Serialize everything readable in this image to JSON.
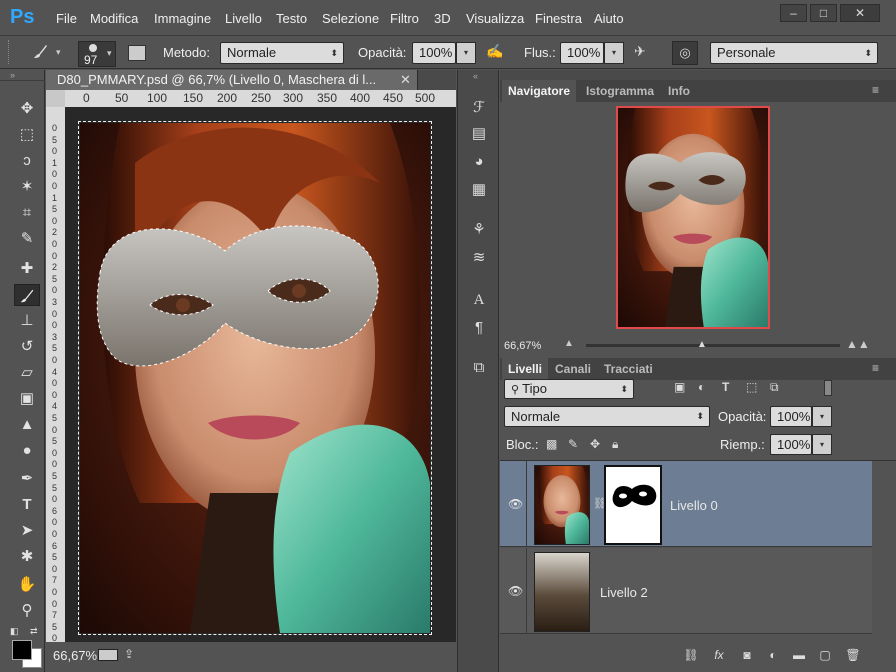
{
  "app": {
    "logo": "Ps",
    "menu": [
      "File",
      "Modifica",
      "Immagine",
      "Livello",
      "Testo",
      "Selezione",
      "Filtro",
      "3D",
      "Visualizza",
      "Finestra",
      "Aiuto"
    ],
    "window_controls": [
      "–",
      "□",
      "✕"
    ]
  },
  "options": {
    "brush_size": "97",
    "metodo_label": "Metodo:",
    "metodo_value": "Normale",
    "opacita_label": "Opacità:",
    "opacita_value": "100%",
    "flusso_label": "Flus.:",
    "flusso_value": "100%",
    "preset_value": "Personale"
  },
  "document": {
    "tab_title": "D80_PMMARY.psd @ 66,7% (Livello 0, Maschera di l...",
    "ruler_top": [
      "0",
      "50",
      "100",
      "150",
      "200",
      "250",
      "300",
      "350",
      "400",
      "450",
      "500"
    ],
    "ruler_left": [
      "0",
      "5",
      "0",
      "1",
      "0",
      "0",
      "1",
      "5",
      "0",
      "2",
      "0",
      "0",
      "2",
      "5",
      "0",
      "3",
      "0",
      "0",
      "3",
      "5",
      "0",
      "4",
      "0",
      "0",
      "4",
      "5",
      "0",
      "5",
      "0",
      "0",
      "5",
      "5",
      "0",
      "6",
      "0",
      "0",
      "6",
      "5",
      "0",
      "7",
      "0",
      "0",
      "7",
      "5",
      "0"
    ],
    "zoom_status": "66,67%"
  },
  "navigator": {
    "tabs": [
      "Navigatore",
      "Istogramma",
      "Info"
    ],
    "zoom": "66,67%",
    "frame_color": "#e04a4a"
  },
  "layers": {
    "tabs": [
      "Livelli",
      "Canali",
      "Tracciati"
    ],
    "filter_value": "Tipo",
    "blend_value": "Normale",
    "opacita_label": "Opacità:",
    "opacita_value": "100%",
    "blocca_label": "Bloc.:",
    "riemp_label": "Riemp.:",
    "riemp_value": "100%",
    "items": [
      {
        "name": "Livello 0",
        "selected": true
      },
      {
        "name": "Livello 2",
        "selected": false
      }
    ],
    "selected_color": "#6d7d93"
  }
}
